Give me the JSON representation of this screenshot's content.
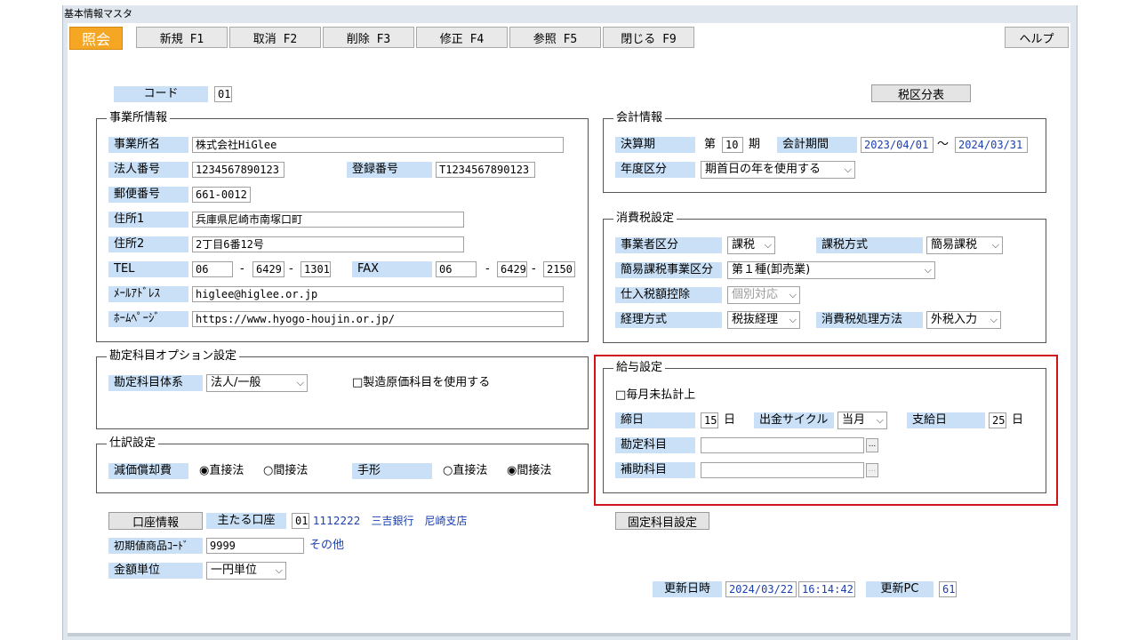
{
  "window": {
    "title": "基本情報マスタ"
  },
  "mode_label": "照会",
  "toolbar": {
    "new": "新規 F1",
    "cancel": "取消 F2",
    "delete": "削除 F3",
    "edit": "修正 F4",
    "refer": "参照 F5",
    "close": "閉じる F9",
    "help": "ヘルプ"
  },
  "code": {
    "label": "コード",
    "value": "01"
  },
  "tax_table_button": "税区分表",
  "office": {
    "title": "事業所情報",
    "name_label": "事業所名",
    "name": "株式会社HiGlee",
    "corp_no_label": "法人番号",
    "corp_no": "1234567890123",
    "reg_no_label": "登録番号",
    "reg_no": "T1234567890123",
    "zip_label": "郵便番号",
    "zip": "661-0012",
    "addr1_label": "住所1",
    "addr1": "兵庫県尼崎市南塚口町",
    "addr2_label": "住所2",
    "addr2": "2丁目6番12号",
    "tel_label": "TEL",
    "tel1": "06",
    "tel2": "6429",
    "tel3": "1301",
    "fax_label": "FAX",
    "fax1": "06",
    "fax2": "6429",
    "fax3": "2150",
    "dash": "-",
    "mail_label": "ﾒｰﾙｱﾄﾞﾚｽ",
    "mail": "higlee@higlee.or.jp",
    "web_label": "ﾎｰﾑﾍﾟｰｼﾞ",
    "web": "https://www.hyogo-houjin.or.jp/"
  },
  "accounting": {
    "title": "会計情報",
    "term_label": "決算期",
    "term_prefix": "第",
    "term": "10",
    "term_suffix": "期",
    "period_label": "会計期間",
    "period_from": "2023/04/01",
    "tilde": "～",
    "period_to": "2024/03/31",
    "year_label": "年度区分",
    "year_value": "期首日の年を使用する"
  },
  "tax": {
    "title": "消費税設定",
    "biz_label": "事業者区分",
    "biz_value": "課税",
    "method_label": "課税方式",
    "method_value": "簡易課税",
    "simple_label": "簡易課税事業区分",
    "simple_value": "第１種(卸売業)",
    "deduct_label": "仕入税額控除",
    "deduct_value": "個別対応",
    "acct_label": "経理方式",
    "acct_value": "税抜経理",
    "proc_label": "消費税処理方法",
    "proc_value": "外税入力"
  },
  "options": {
    "title": "勘定科目オプション設定",
    "system_label": "勘定科目体系",
    "system_value": "法人/一般",
    "mfg_checkbox": "□製造原価科目を使用する"
  },
  "payroll": {
    "title": "給与設定",
    "unpaid_checkbox": "□毎月未払計上",
    "close_label": "締日",
    "close_value": "15",
    "day": "日",
    "cycle_label": "出金サイクル",
    "cycle_value": "当月",
    "pay_label": "支給日",
    "pay_value": "25",
    "acct_label": "勘定科目",
    "sub_label": "補助科目",
    "browse": "..."
  },
  "journal": {
    "title": "仕訳設定",
    "dep_label": "減価償却費",
    "dep_direct": "◉直接法",
    "dep_indirect": "○間接法",
    "bill_label": "手形",
    "bill_direct": "○直接法",
    "bill_indirect": "◉間接法"
  },
  "bank": {
    "button": "口座情報",
    "main_label": "主たる口座",
    "code": "01",
    "detail": "1112222　三吉銀行　尼崎支店"
  },
  "init_goods": {
    "label": "初期値商品ｺｰﾄﾞ",
    "value": "9999",
    "name": "その他"
  },
  "unit": {
    "label": "金額単位",
    "value": "一円単位"
  },
  "fixed_button": "固定科目設定",
  "update": {
    "date_label": "更新日時",
    "date": "2024/03/22",
    "time": "16:14:42",
    "pc_label": "更新PC",
    "pc": "61"
  }
}
